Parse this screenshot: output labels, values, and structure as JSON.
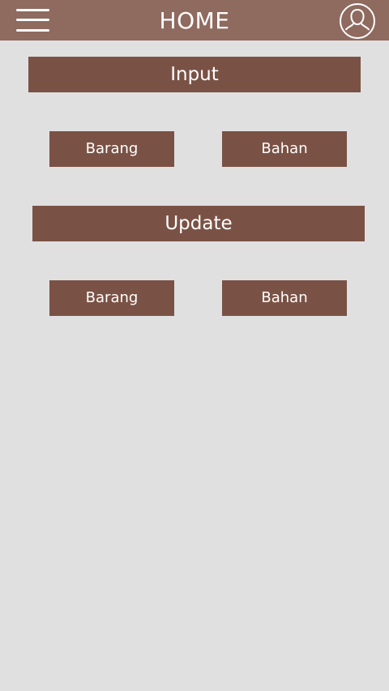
{
  "header": {
    "title": "HOME",
    "menu_icon": "hamburger-menu-icon",
    "profile_icon": "user-profile-icon"
  },
  "input_section": {
    "label": "Input",
    "barang_label": "Barang",
    "bahan_label": "Bahan"
  },
  "update_section": {
    "label": "Update",
    "barang_label": "Barang",
    "bahan_label": "Bahan"
  },
  "colors": {
    "appbar": "#8f6a5f",
    "button": "#7a5245",
    "background": "#e0e0e0",
    "text": "#ffffff"
  }
}
